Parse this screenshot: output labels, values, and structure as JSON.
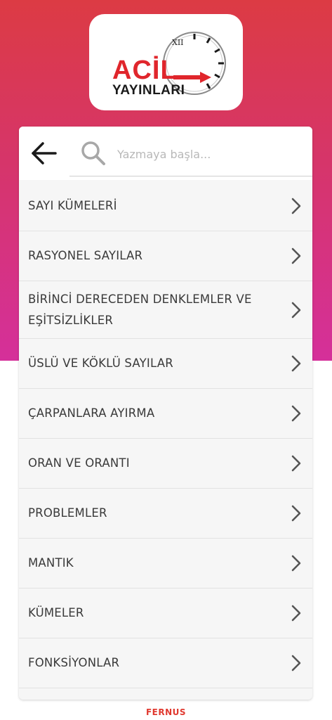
{
  "logo": {
    "brand_top": "ACİL",
    "brand_bottom": "YAYINLARI",
    "clock_numeral": "XII"
  },
  "search": {
    "placeholder": "Yazmaya başla..."
  },
  "topics": [
    {
      "label": "SAYI KÜMELERİ"
    },
    {
      "label": "RASYONEL SAYILAR"
    },
    {
      "label": "BİRİNCİ DERECEDEN DENKLEMLER VE EŞİTSİZLİKLER"
    },
    {
      "label": "ÜSLÜ VE KÖKLÜ SAYILAR"
    },
    {
      "label": "ÇARPANLARA AYIRMA"
    },
    {
      "label": "ORAN VE ORANTI"
    },
    {
      "label": "PROBLEMLER"
    },
    {
      "label": "MANTIK"
    },
    {
      "label": "KÜMELER"
    },
    {
      "label": "FONKSİYONLAR"
    }
  ],
  "footer": {
    "brand": "FERNUS"
  },
  "colors": {
    "gradient_top": "#dc3b44",
    "gradient_bottom": "#d5309a",
    "logo_red": "#e0262c",
    "chevron": "#555555"
  }
}
